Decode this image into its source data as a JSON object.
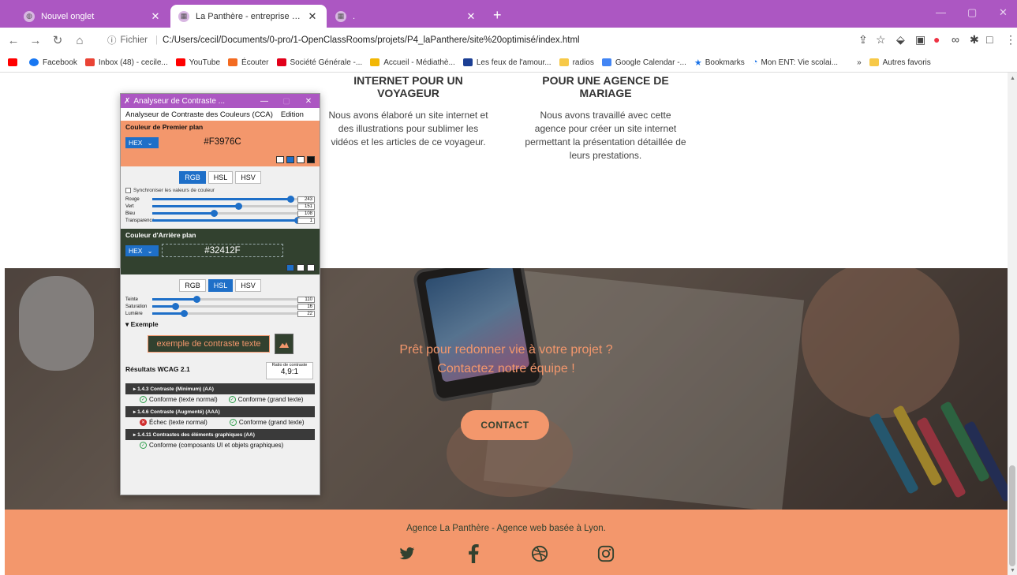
{
  "browser": {
    "tabs": [
      {
        "title": "Nouvel onglet",
        "active": false
      },
      {
        "title": "La Panthère - entreprise web des",
        "active": true
      },
      {
        "title": ".",
        "active": false
      }
    ],
    "new_tab": "+",
    "address": {
      "protocol": "Fichier",
      "url": "C:/Users/cecil/Documents/0-pro/1-OpenClassRooms/projets/P4_laPanthere/site%20optimisé/index.html"
    },
    "bookmarks": [
      {
        "label": "Facebook",
        "color": "#1877f2"
      },
      {
        "label": "Inbox (48) - cecile...",
        "color": "#ea4335"
      },
      {
        "label": "YouTube",
        "color": "#ff0000"
      },
      {
        "label": "Écouter",
        "color": "#f36b21"
      },
      {
        "label": "Société Générale -...",
        "color": "#e2001a"
      },
      {
        "label": "Accueil - Médiathè...",
        "color": "#f2b705"
      },
      {
        "label": "Les feux de l'amour...",
        "color": "#1c3f94"
      },
      {
        "label": "radios",
        "color": "#f7c948"
      },
      {
        "label": "Google Calendar -...",
        "color": "#4285f4"
      },
      {
        "label": "Bookmarks",
        "color": "#1a73e8"
      },
      {
        "label": "Mon ENT: Vie scolai...",
        "color": "#1a73e8"
      }
    ],
    "more_bookmarks": "»",
    "other_bookmarks": "Autres favoris"
  },
  "page": {
    "cards": [
      {
        "title_lines": [
          "INTERNET POUR UN",
          "VOYAGEUR"
        ],
        "text_lines": [
          "Nous avons élaboré un site internet et",
          "des illustrations pour sublimer les",
          "vidéos et les articles de ce voyageur."
        ]
      },
      {
        "title_lines": [
          "POUR UNE AGENCE DE",
          "MARIAGE"
        ],
        "text_lines": [
          "Nous avons travaillé avec cette",
          "agence pour créer un site internet",
          "permettant la présentation détaillée de",
          "leurs prestations."
        ]
      }
    ],
    "hero": {
      "line1": "Prêt pour redonner vie à votre projet ?",
      "line2": "Contactez notre équipe !",
      "cta": "CONTACT"
    },
    "footer": {
      "tagline": "Agence La Panthère - Agence web basée à Lyon.",
      "social_icons": [
        "twitter-icon",
        "facebook-icon",
        "dribbble-icon",
        "instagram-icon"
      ]
    }
  },
  "cca": {
    "window_title": "Analyseur de Contraste ...",
    "menu": [
      "Analyseur de Contraste des Couleurs (CCA)",
      "Edition"
    ],
    "foreground": {
      "heading": "Couleur de Premier plan",
      "format": "HEX",
      "value": "#F3976C",
      "modes": [
        "RGB",
        "HSL",
        "HSV"
      ],
      "active_mode": "RGB",
      "sync_label": "Synchroniser les valeurs de couleur",
      "sliders": [
        {
          "label": "Rouge",
          "value": "243",
          "fraction": 0.953
        },
        {
          "label": "Vert",
          "value": "151",
          "fraction": 0.592
        },
        {
          "label": "Bleu",
          "value": "108",
          "fraction": 0.424
        },
        {
          "label": "Transparence",
          "value": "1",
          "fraction": 1.0
        }
      ]
    },
    "background": {
      "heading": "Couleur d'Arrière plan",
      "format": "HEX",
      "value": "#32412F",
      "modes": [
        "RGB",
        "HSL",
        "HSV"
      ],
      "active_mode": "HSL",
      "sliders": [
        {
          "label": "Teinte",
          "value": "110",
          "fraction": 0.306
        },
        {
          "label": "Saturation",
          "value": "16",
          "fraction": 0.16
        },
        {
          "label": "Lumière",
          "value": "22",
          "fraction": 0.22
        }
      ]
    },
    "example": {
      "heading": "▾ Exemple",
      "sample_text": "exemple de contraste texte"
    },
    "results": {
      "heading": "Résultats WCAG 2.1",
      "ratio_label": "Ratio de contraste",
      "ratio_value": "4,9:1",
      "criteria": [
        {
          "title": "▸ 1.4.3 Contraste (Minimum) (AA)",
          "results": [
            {
              "text": "Conforme (texte normal)",
              "pass": true
            },
            {
              "text": "Conforme (grand texte)",
              "pass": true
            }
          ]
        },
        {
          "title": "▸ 1.4.6 Contraste (Augmenté) (AAA)",
          "results": [
            {
              "text": "Échec (texte normal)",
              "pass": false
            },
            {
              "text": "Conforme (grand texte)",
              "pass": true
            }
          ]
        },
        {
          "title": "▸ 1.4.11 Contrastes des éléments graphiques (AA)",
          "results": [
            {
              "text": "Conforme (composants UI et objets graphiques)",
              "pass": true
            }
          ]
        }
      ]
    }
  },
  "colors": {
    "accent": "#f3976c",
    "dark_green": "#32412f",
    "chrome": "#ac57c2"
  }
}
